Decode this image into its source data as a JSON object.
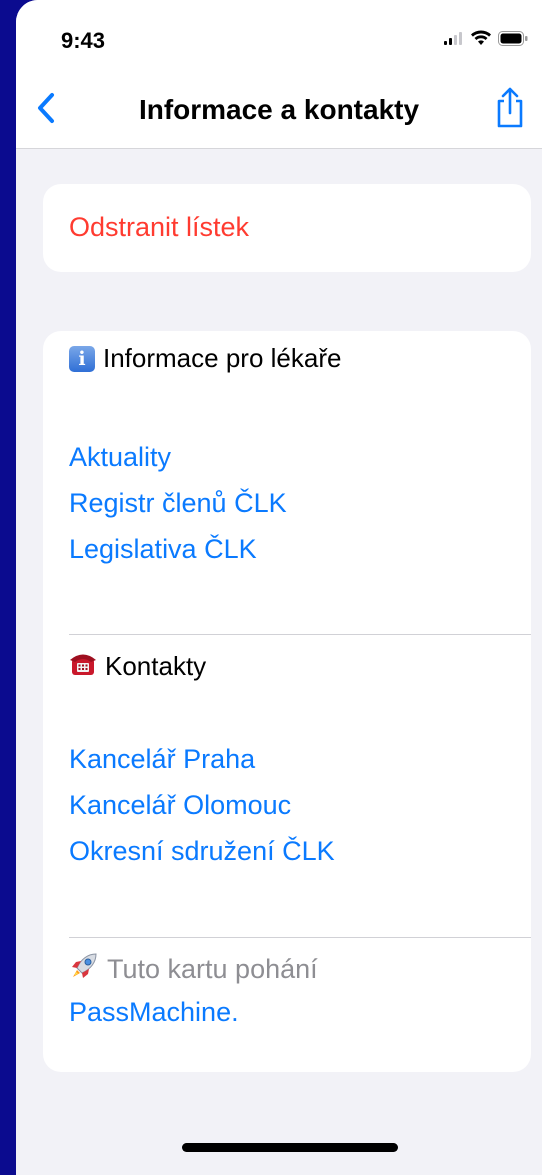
{
  "status_bar": {
    "time": "9:43",
    "icons": [
      "signal-icon",
      "wifi-icon",
      "battery-icon"
    ]
  },
  "nav": {
    "title": "Informace a kontakty",
    "back_icon": "chevron-left-icon",
    "share_icon": "share-icon"
  },
  "delete_card": {
    "label": "Odstranit lístek"
  },
  "info_section": {
    "icon": "info-icon",
    "heading": "Informace pro lékaře",
    "links": [
      "Aktuality",
      "Registr členů ČLK",
      "Legislativa ČLK"
    ]
  },
  "contacts_section": {
    "icon": "telephone-icon",
    "heading": "Kontakty",
    "links": [
      "Kancelář Praha",
      "Kancelář Olomouc",
      "Okresní sdružení ČLK"
    ]
  },
  "footer": {
    "icon": "rocket-icon",
    "text": "Tuto kartu pohání",
    "link": "PassMachine."
  },
  "colors": {
    "accent": "#0a7aff",
    "destructive": "#ff3b30",
    "secondary_text": "#8e8e93",
    "background": "#f2f2f7",
    "outer_background": "#0b0b8f"
  }
}
